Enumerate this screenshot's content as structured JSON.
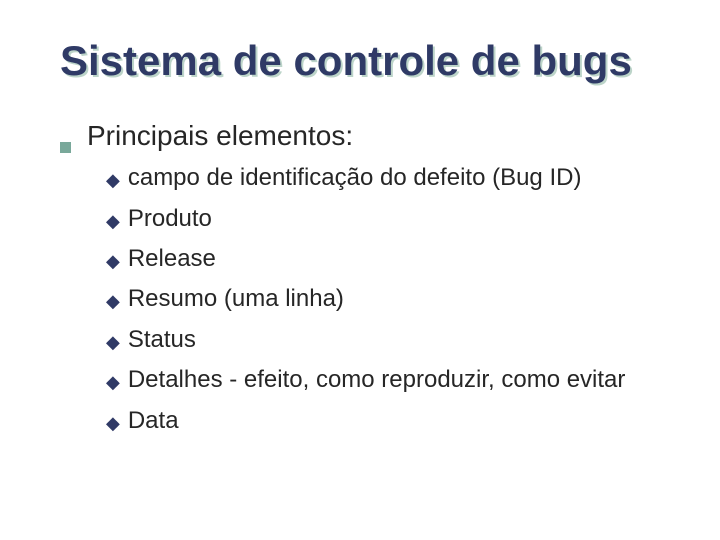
{
  "title": "Sistema de controle de bugs",
  "level1": {
    "heading": "Principais elementos:"
  },
  "level2": {
    "items": [
      {
        "text": "campo de identificação do defeito (Bug ID)"
      },
      {
        "text": "Produto"
      },
      {
        "text": "Release"
      },
      {
        "text": "Resumo (uma linha)"
      },
      {
        "text": "Status"
      },
      {
        "text": "Detalhes - efeito, como reproduzir, como evitar"
      },
      {
        "text": "Data"
      }
    ]
  }
}
